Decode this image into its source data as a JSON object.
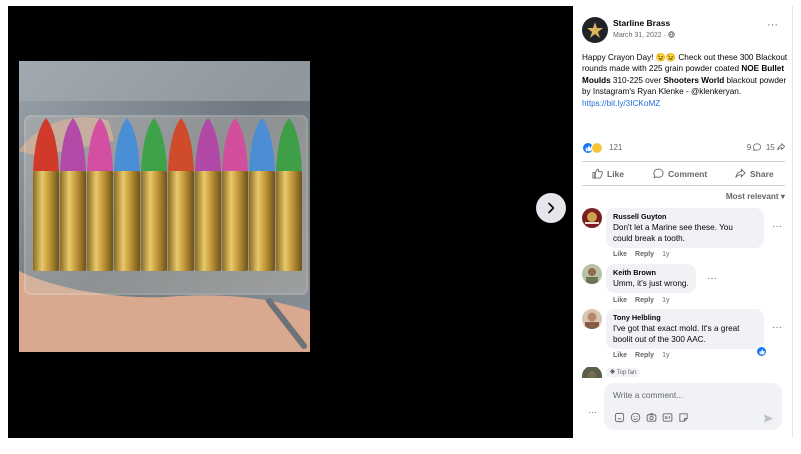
{
  "post": {
    "page_name": "Starline Brass",
    "date": "March 31, 2022 · ",
    "text_1": "Happy Crayon Day! 😉😉 Check out these 300 Blackout rounds made with 225 grain powder coated ",
    "text_bold_1": "NOE Bullet Moulds",
    "text_2": " 310-225 over ",
    "text_bold_2": "Shooters World",
    "text_3": " blackout powder by Instagram's Ryan Klenke - @klenkeryan.",
    "link": "https://bit.ly/3ICKoMZ",
    "more": "···"
  },
  "stats": {
    "reactions": "121",
    "comments": "9",
    "shares": "15"
  },
  "actions": {
    "like": "Like",
    "comment": "Comment",
    "share": "Share"
  },
  "sort": "Most relevant ▾",
  "comments": [
    {
      "name": "Russell Guyton",
      "line1": "Don't let a Marine see these. You",
      "line2": "could break a tooth.",
      "like": "Like",
      "reply": "Reply",
      "time": "1y"
    },
    {
      "name": "Keith Brown",
      "line1": "Umm, it's just wrong.",
      "line2": "",
      "like": "Like",
      "reply": "Reply",
      "time": "1y"
    },
    {
      "name": "Tony Helbling",
      "line1": "I've got that exact mold. It's a great",
      "line2": "boolit out of the 300 AAC.",
      "like": "Like",
      "reply": "Reply",
      "time": "1y"
    }
  ],
  "top_fan": "Top fan",
  "composer": {
    "placeholder": "Write a comment..."
  },
  "colors": {
    "accent": "#1877f2",
    "link": "#216fdb",
    "bubble": "#f0f2f5",
    "viewer_bg": "#000000"
  },
  "icons": [
    "next-arrow-icon",
    "globe-icon",
    "like-icon",
    "comment-icon",
    "share-icon",
    "camera-icon",
    "gif-icon",
    "sticker-icon",
    "emoji-icon",
    "send-icon"
  ]
}
